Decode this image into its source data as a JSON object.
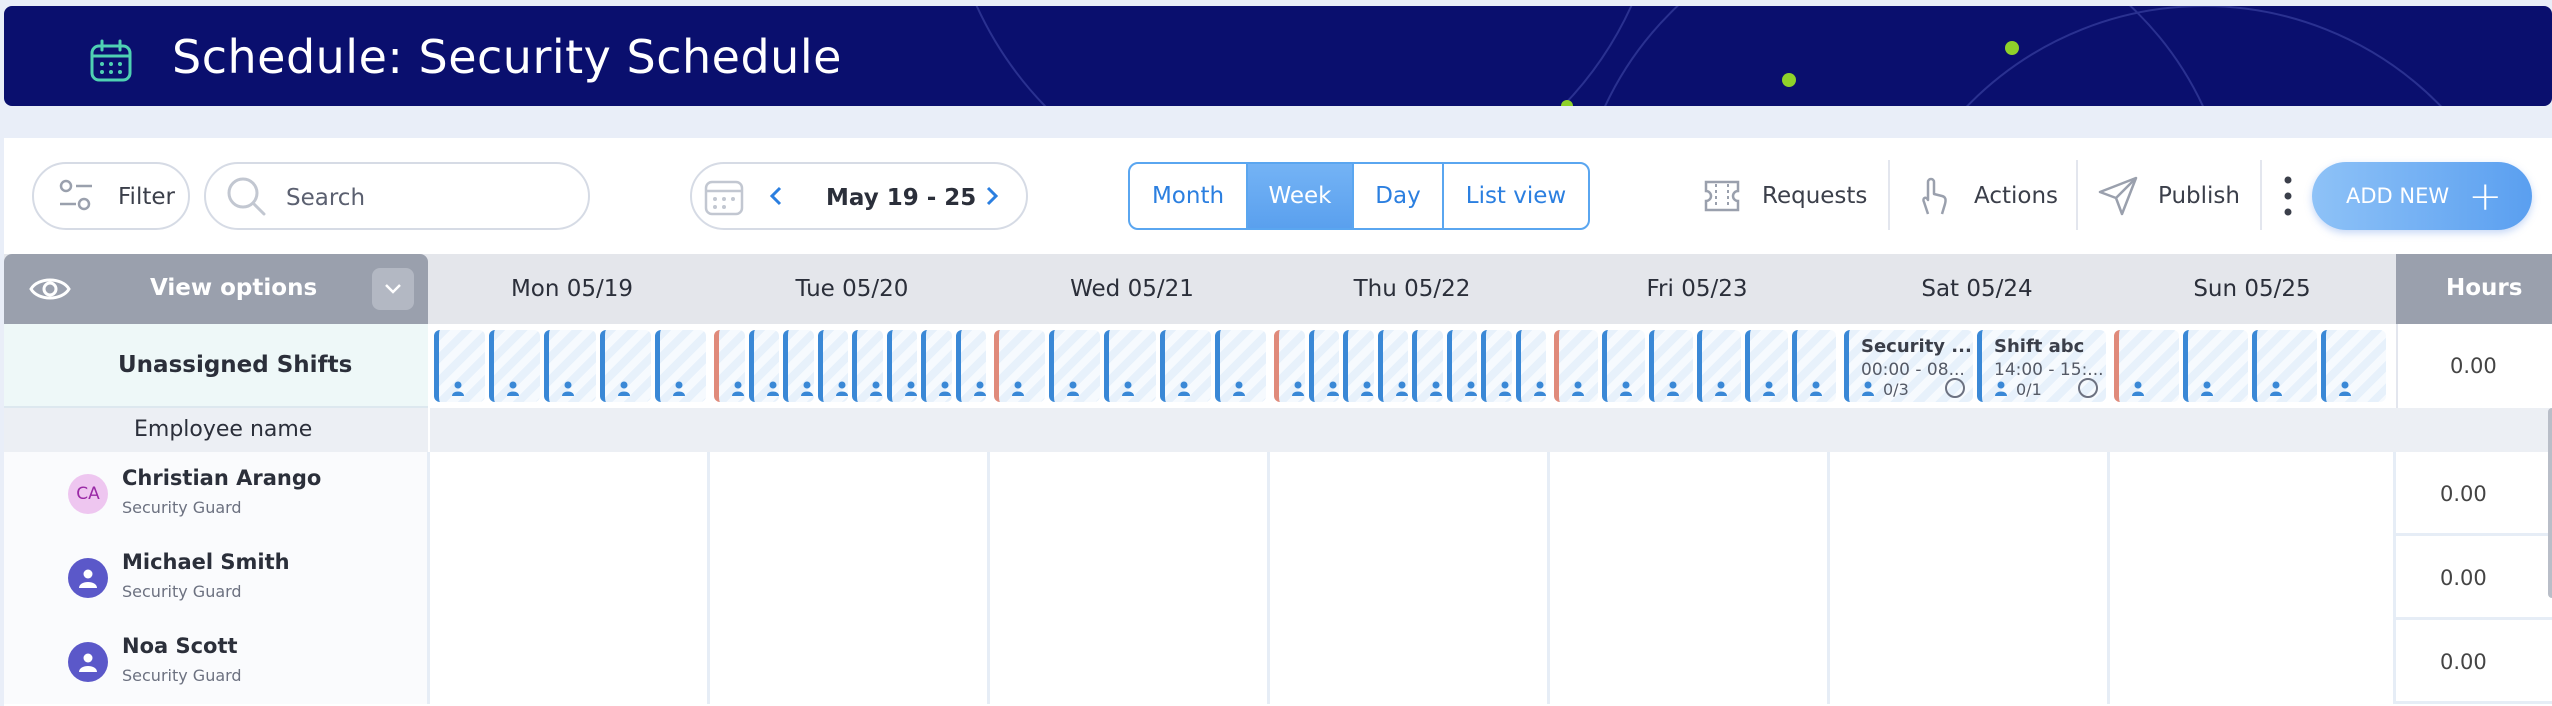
{
  "header": {
    "title": "Schedule: Security Schedule"
  },
  "toolbar": {
    "filter_label": "Filter",
    "search_placeholder": "Search",
    "date_range": "May 19 - 25",
    "views": [
      "Month",
      "Week",
      "Day",
      "List view"
    ],
    "active_view": "Week",
    "requests_label": "Requests",
    "actions_label": "Actions",
    "publish_label": "Publish",
    "add_new_label": "ADD NEW"
  },
  "grid": {
    "view_options_label": "View options",
    "days": [
      "Mon 05/19",
      "Tue 05/20",
      "Wed 05/21",
      "Thu 05/22",
      "Fri 05/23",
      "Sat 05/24",
      "Sun 05/25"
    ],
    "hours_label": "Hours",
    "unassigned_label": "Unassigned Shifts",
    "unassigned_hours": "0.00",
    "employee_name_label": "Employee name",
    "open_shifts": [
      {
        "title": "Security ...",
        "time": "00:00 - 08...",
        "count": "0/3"
      },
      {
        "title": "Shift abc",
        "time": "14:00 - 15:...",
        "count": "0/1"
      }
    ],
    "employees": [
      {
        "name": "Christian Arango",
        "role": "Security Guard",
        "initials": "CA",
        "hours": "0.00"
      },
      {
        "name": "Michael Smith",
        "role": "Security Guard",
        "initials": "",
        "hours": "0.00"
      },
      {
        "name": "Noa Scott",
        "role": "Security Guard",
        "initials": "",
        "hours": "0.00"
      }
    ]
  },
  "colors": {
    "header_bg": "#0a0f6e",
    "accent": "#5aa6f0",
    "shift_border": "#3a88d6",
    "avatar_person": "#5b58c9"
  }
}
